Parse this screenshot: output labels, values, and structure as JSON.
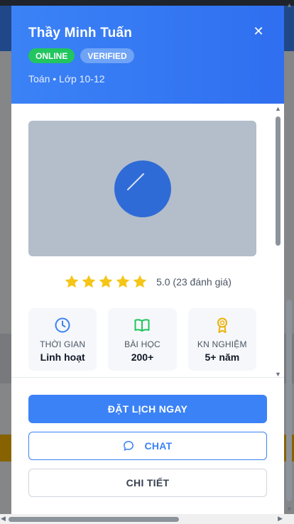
{
  "tutor": {
    "name": "Thầy Minh Tuấn",
    "status_badge": "ONLINE",
    "verified_badge": "VERIFIED",
    "subject_line": "Toán • Lớp 10-12"
  },
  "close_icon": "✕",
  "media": {
    "icon": "play-icon"
  },
  "rating": {
    "value": 5.0,
    "stars": 5,
    "text": "5.0 (23 đánh giá)"
  },
  "stats": [
    {
      "icon": "clock-icon",
      "label": "THỜI GIAN",
      "value": "Linh hoạt"
    },
    {
      "icon": "book-icon",
      "label": "BÀI HỌC",
      "value": "200+"
    },
    {
      "icon": "award-icon",
      "label": "KN NGHIỆM",
      "value": "5+ năm"
    }
  ],
  "actions": {
    "book_label": "ĐẶT LỊCH NGAY",
    "chat_label": "CHAT",
    "details_label": "CHI TIẾT"
  },
  "colors": {
    "primary": "#3b82f6",
    "online": "#22c55e",
    "star": "#f5c518"
  }
}
